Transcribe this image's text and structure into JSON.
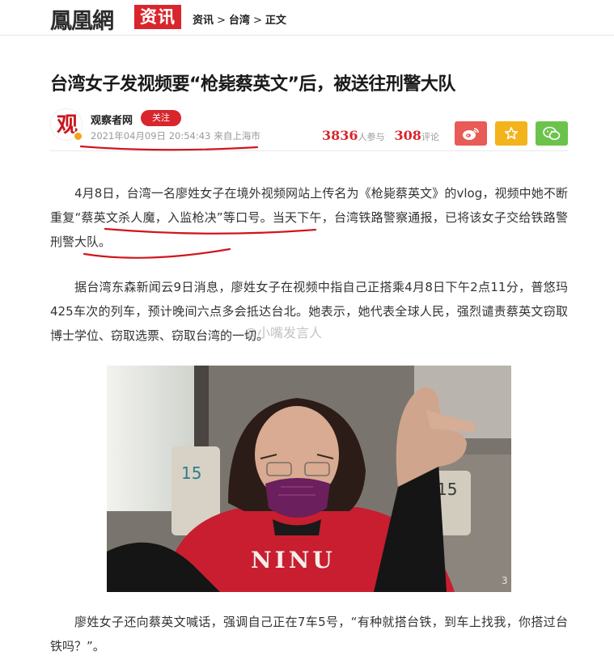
{
  "header": {
    "logo_text": "鳳凰網",
    "logo_tag": "资讯",
    "breadcrumb": [
      "资讯",
      "台湾",
      "正文"
    ],
    "breadcrumb_sep": ">"
  },
  "article": {
    "title": "台湾女子发视频要“枪毙蔡英文”后，被送往刑警大队",
    "source": {
      "avatar_char": "观",
      "name": "观察者网",
      "follow_label": "关注",
      "date": "2021年04月09日 20:54:43",
      "origin": "来自上海市"
    },
    "stats": {
      "participants": "3836",
      "participants_label": "人参与",
      "comments": "308",
      "comments_label": "评论"
    },
    "share_icons": [
      "weibo-icon",
      "star-icon",
      "wechat-icon"
    ],
    "paragraphs": [
      "4月8日，台湾一名廖姓女子在境外视频网站上传名为《枪毙蔡英文》的vlog，视频中她不断重复“蔡英文杀人魔，入监枪决”等口号。当天下午，台湾铁路警察通报，已将该女子交给铁路警刑警大队。",
      "据台湾东森新闻云9日消息，廖姓女子在视频中指自己正搭乘4月8日下午2点11分，普悠玛425车次的列车，预计晚间六点多会抵达台北。她表示，她代表全球人民，强烈谴责蔡英文窃取博士学位、窃取选票、窃取台湾的一切。",
      "廖姓女子还向蔡英文喊话，强调自己正在7车5号，“有种就搭台铁，到车上找我，你搭过台铁吗？”。"
    ],
    "photo": {
      "seat_number": "15",
      "shirt_text": "NINU",
      "corner_text": "3"
    },
    "watermark": "@小嘴发言人"
  },
  "colors": {
    "brand_red": "#d8262c",
    "annotation_red": "#d0161d",
    "weibo": "#e85b57",
    "star": "#f3b31c",
    "wechat": "#6cc34c"
  }
}
